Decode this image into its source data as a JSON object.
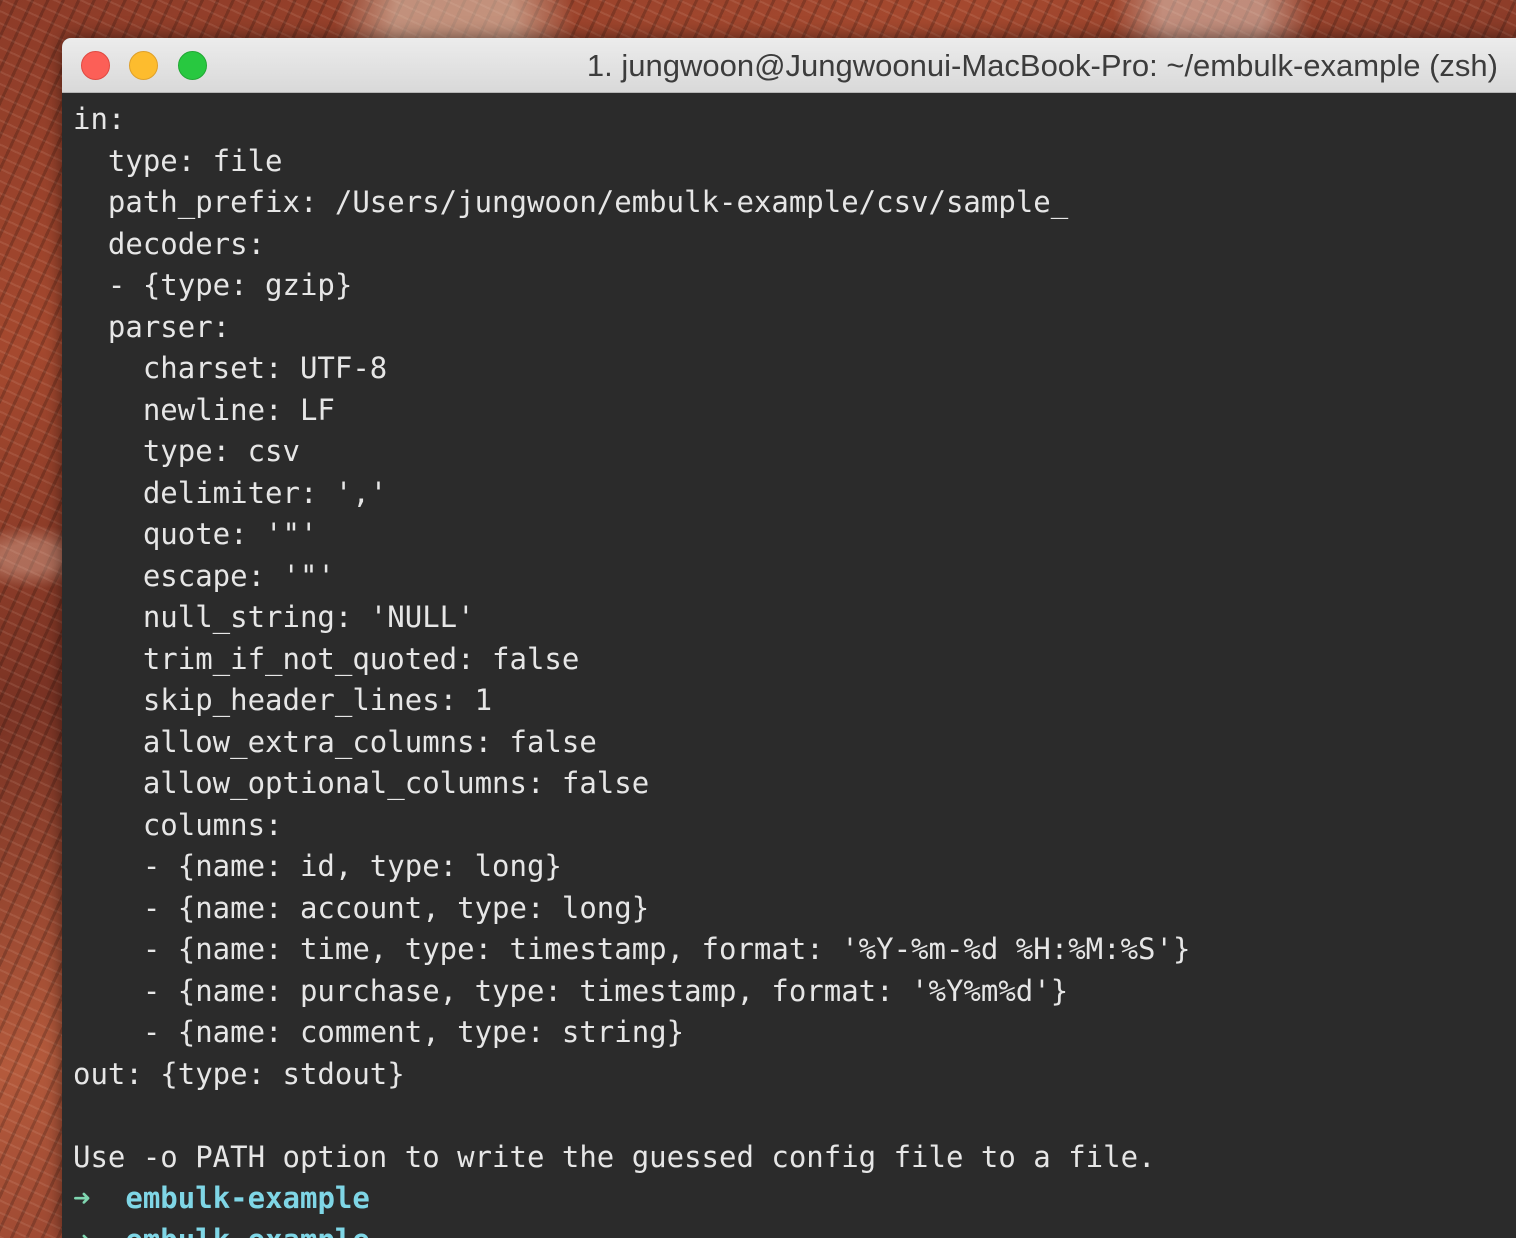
{
  "window": {
    "title": "1. jungwoon@Jungwoonui-MacBook-Pro: ~/embulk-example (zsh)",
    "controls": {
      "close_color": "#fc5f57",
      "minimize_color": "#fdbc2e",
      "zoom_color": "#28c840"
    }
  },
  "terminal": {
    "background": "#2b2b2b",
    "lines": [
      "in:",
      "  type: file",
      "  path_prefix: /Users/jungwoon/embulk-example/csv/sample_",
      "  decoders:",
      "  - {type: gzip}",
      "  parser:",
      "    charset: UTF-8",
      "    newline: LF",
      "    type: csv",
      "    delimiter: ','",
      "    quote: '\"'",
      "    escape: '\"'",
      "    null_string: 'NULL'",
      "    trim_if_not_quoted: false",
      "    skip_header_lines: 1",
      "    allow_extra_columns: false",
      "    allow_optional_columns: false",
      "    columns:",
      "    - {name: id, type: long}",
      "    - {name: account, type: long}",
      "    - {name: time, type: timestamp, format: '%Y-%m-%d %H:%M:%S'}",
      "    - {name: purchase, type: timestamp, format: '%Y%m%d'}",
      "    - {name: comment, type: string}",
      "out: {type: stdout}",
      "",
      "Use -o PATH option to write the guessed config file to a file."
    ],
    "prompts": [
      {
        "arrow": "➜",
        "dir": "embulk-example"
      },
      {
        "arrow": "➜",
        "dir": "embulk-example"
      }
    ]
  }
}
